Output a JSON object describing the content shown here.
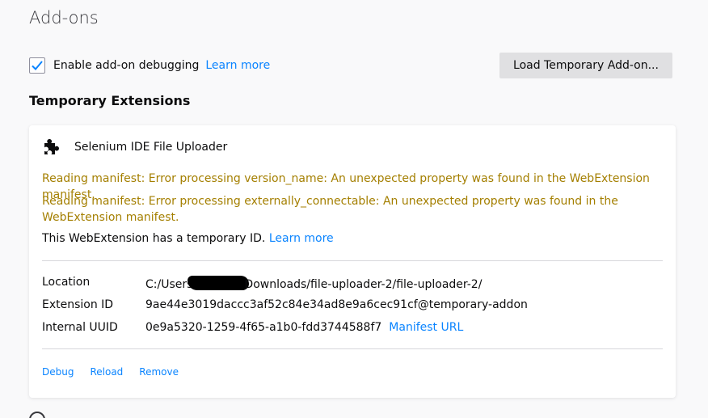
{
  "page": {
    "title": "Add-ons"
  },
  "debugging": {
    "checked": true,
    "label": "Enable add-on debugging",
    "learn_more": "Learn more"
  },
  "load_button": "Load Temporary Add-on...",
  "section_title": "Temporary Extensions",
  "extension": {
    "icon": "puzzle-piece-icon",
    "name": "Selenium IDE File Uploader",
    "warnings": [
      "Reading manifest: Error processing version_name: An unexpected property was found in the WebExtension manifest.",
      "Reading manifest: Error processing externally_connectable: An unexpected property was found in the WebExtension manifest."
    ],
    "temporary_note": "This WebExtension has a temporary ID.",
    "temporary_learn_more": "Learn more",
    "details": [
      {
        "label": "Location",
        "value_prefix": "C:/Users",
        "value_suffix": "Downloads/file-uploader-2/file-uploader-2/"
      },
      {
        "label": "Extension ID",
        "value": "9ae44e3019daccc3af52c84e34ad8e9a6cec91cf@temporary-addon"
      },
      {
        "label": "Internal UUID",
        "value": "0e9a5320-1259-4f65-a1b0-fdd3744588f7",
        "link": "Manifest URL"
      }
    ],
    "actions": [
      "Debug",
      "Reload",
      "Remove"
    ]
  },
  "colors": {
    "link": "#0a84ff",
    "warning": "#a47f00",
    "background": "#f9f9fa"
  }
}
